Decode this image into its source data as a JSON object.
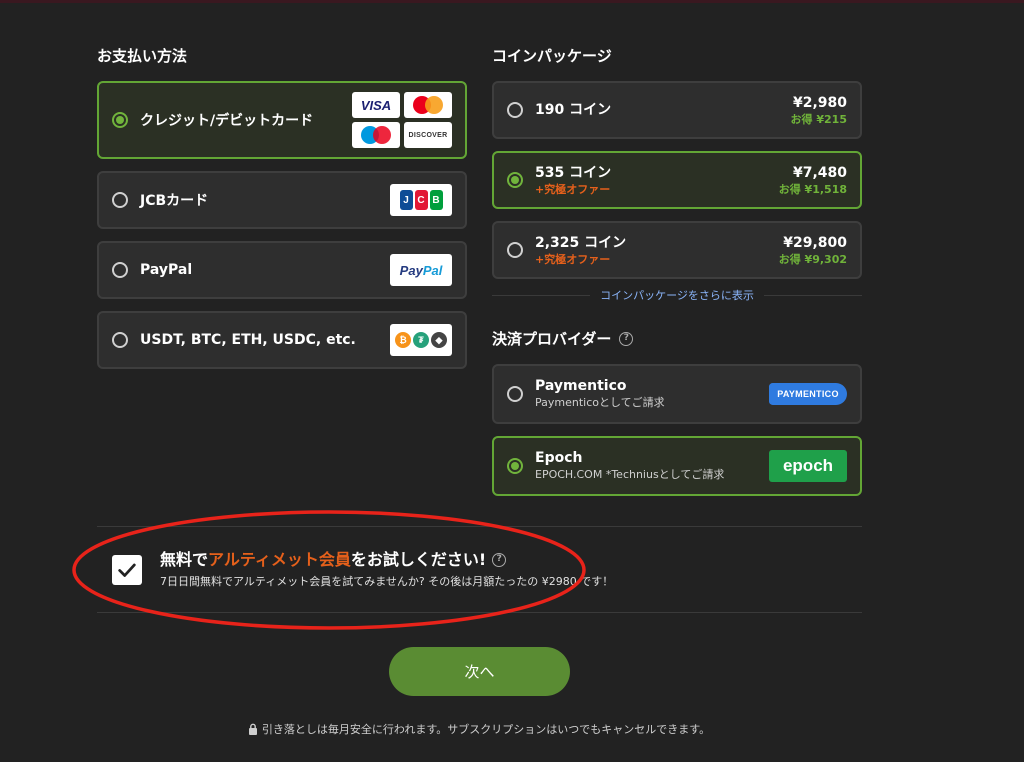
{
  "payment_methods": {
    "heading": "お支払い方法",
    "options": [
      {
        "label": "クレジット/デビットカード",
        "selected": true
      },
      {
        "label": "JCBカード",
        "selected": false
      },
      {
        "label": "PayPal",
        "selected": false
      },
      {
        "label": "USDT, BTC, ETH, USDC, etc.",
        "selected": false
      }
    ],
    "logos": {
      "visa": "VISA",
      "discover": "DISCOVER",
      "jcb": [
        "J",
        "C",
        "B"
      ],
      "paypal_a": "Pay",
      "paypal_b": "Pal"
    }
  },
  "coin_packages": {
    "heading": "コインパッケージ",
    "items": [
      {
        "name": "190 コイン",
        "offer": "",
        "price": "¥2,980",
        "saving": "お得 ¥215",
        "selected": false
      },
      {
        "name": "535 コイン",
        "offer": "+究極オファー",
        "price": "¥7,480",
        "saving": "お得 ¥1,518",
        "selected": true
      },
      {
        "name": "2,325 コイン",
        "offer": "+究極オファー",
        "price": "¥29,800",
        "saving": "お得 ¥9,302",
        "selected": false
      }
    ],
    "show_more": "コインパッケージをさらに表示"
  },
  "providers": {
    "heading": "決済プロバイダー",
    "items": [
      {
        "name": "Paymentico",
        "sub": "Paymenticoとしてご請求",
        "logo": "PAYMENTICO",
        "selected": false
      },
      {
        "name": "Epoch",
        "sub": "EPOCH.COM *Techniusとしてご請求",
        "logo": "epoch",
        "selected": true
      }
    ]
  },
  "trial": {
    "title_a": "無料で",
    "title_accent": "アルティメット会員",
    "title_b": "をお試しください!",
    "description": "7日日間無料でアルティメット会員を試てみませんか? その後は月額たったの ¥2980 です！",
    "checked": true
  },
  "next_button": "次へ",
  "footer": "引き落としは毎月安全に行われます。サブスクリプションはいつでもキャンセルできます。",
  "colors": {
    "accent_green": "#63a635",
    "offer_orange": "#e5601b",
    "highlight_red": "#e8231a"
  }
}
